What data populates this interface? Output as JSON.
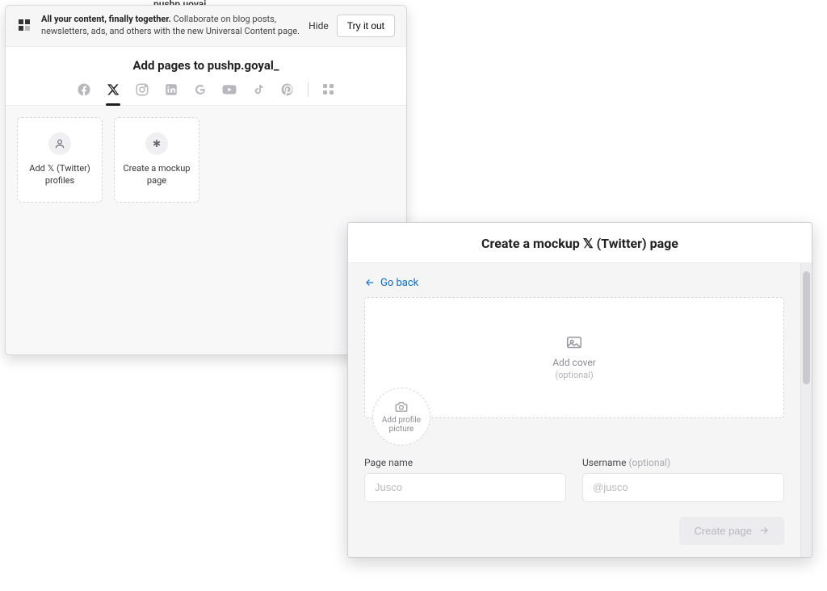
{
  "background": {
    "partial_label": "pushp.uovai"
  },
  "panel1": {
    "banner": {
      "icon": "content-grid-icon",
      "bold": "All your content, finally together.",
      "rest": "Collaborate on blog posts, newsletters, ads, and others with the new Universal Content page.",
      "hide": "Hide",
      "try": "Try it out"
    },
    "title": "Add pages to pushp.goyal_",
    "tabs": [
      {
        "name": "facebook-icon",
        "active": false
      },
      {
        "name": "x-twitter-icon",
        "active": true
      },
      {
        "name": "instagram-icon",
        "active": false
      },
      {
        "name": "linkedin-icon",
        "active": false
      },
      {
        "name": "google-icon",
        "active": false
      },
      {
        "name": "youtube-icon",
        "active": false
      },
      {
        "name": "tiktok-icon",
        "active": false
      },
      {
        "name": "pinterest-icon",
        "active": false
      }
    ],
    "extra_tab": {
      "name": "more-apps-icon"
    },
    "cards": [
      {
        "icon": "person-icon",
        "glyph": "👤",
        "label": "Add 𝕏 (Twitter) profiles"
      },
      {
        "icon": "asterisk-icon",
        "glyph": "✱",
        "label": "Create a mockup page"
      }
    ]
  },
  "panel2": {
    "title": "Create a mockup 𝕏 (Twitter) page",
    "go_back": "Go back",
    "cover": {
      "label": "Add cover",
      "sub": "(optional)",
      "icon": "image-icon"
    },
    "avatar": {
      "line1": "Add profile",
      "line2": "picture",
      "icon": "camera-icon"
    },
    "page_name": {
      "label": "Page name",
      "placeholder": "Jusco"
    },
    "username": {
      "label": "Username",
      "optional": "(optional)",
      "placeholder": "@jusco"
    },
    "create_btn": "Create page"
  }
}
